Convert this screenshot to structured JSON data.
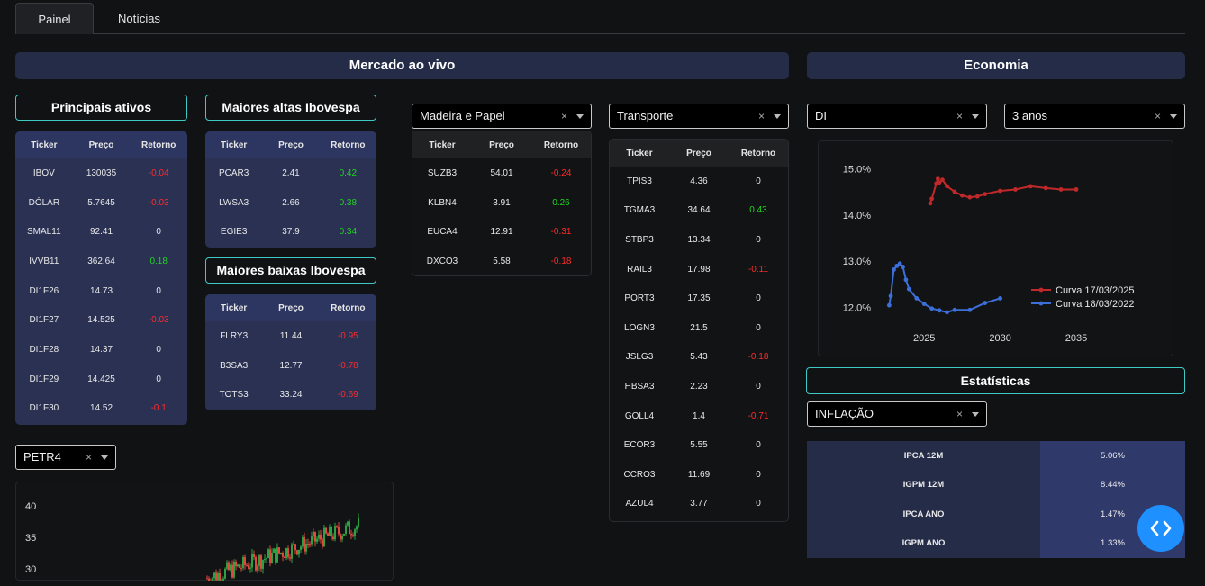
{
  "tabs": [
    "Painel",
    "Notícias"
  ],
  "sections": {
    "market": "Mercado ao vivo",
    "economy": "Economia",
    "stats": "Estatísticas"
  },
  "boxes": {
    "main_assets": "Principais ativos",
    "top_gainers": "Maiores altas Ibovespa",
    "top_losers": "Maiores baixas Ibovespa"
  },
  "table_headers": [
    "Ticker",
    "Preço",
    "Retorno"
  ],
  "main_assets": [
    [
      "IBOV",
      "130035",
      "-0.04"
    ],
    [
      "DÓLAR",
      "5.7645",
      "-0.03"
    ],
    [
      "SMAL11",
      "92.41",
      "0"
    ],
    [
      "IVVB11",
      "362.64",
      "0.18"
    ],
    [
      "DI1F26",
      "14.73",
      "0"
    ],
    [
      "DI1F27",
      "14.525",
      "-0.03"
    ],
    [
      "DI1F28",
      "14.37",
      "0"
    ],
    [
      "DI1F29",
      "14.425",
      "0"
    ],
    [
      "DI1F30",
      "14.52",
      "-0.1"
    ]
  ],
  "top_gainers": [
    [
      "PCAR3",
      "2.41",
      "0.42"
    ],
    [
      "LWSA3",
      "2.66",
      "0.38"
    ],
    [
      "EGIE3",
      "37.9",
      "0.34"
    ]
  ],
  "top_losers": [
    [
      "FLRY3",
      "11.44",
      "-0.95"
    ],
    [
      "B3SA3",
      "12.77",
      "-0.78"
    ],
    [
      "TOTS3",
      "33.24",
      "-0.69"
    ]
  ],
  "sector1": {
    "selected": "Madeira e Papel",
    "rows": [
      [
        "SUZB3",
        "54.01",
        "-0.24"
      ],
      [
        "KLBN4",
        "3.91",
        "0.26"
      ],
      [
        "EUCA4",
        "12.91",
        "-0.31"
      ],
      [
        "DXCO3",
        "5.58",
        "-0.18"
      ]
    ]
  },
  "sector2": {
    "selected": "Transporte",
    "rows": [
      [
        "TPIS3",
        "4.36",
        "0"
      ],
      [
        "TGMA3",
        "34.64",
        "0.43"
      ],
      [
        "STBP3",
        "13.34",
        "0"
      ],
      [
        "RAIL3",
        "17.98",
        "-0.11"
      ],
      [
        "PORT3",
        "17.35",
        "0"
      ],
      [
        "LOGN3",
        "21.5",
        "0"
      ],
      [
        "JSLG3",
        "5.43",
        "-0.18"
      ],
      [
        "HBSA3",
        "2.23",
        "0"
      ],
      [
        "GOLL4",
        "1.4",
        "-0.71"
      ],
      [
        "ECOR3",
        "5.55",
        "0"
      ],
      [
        "CCRO3",
        "11.69",
        "0"
      ],
      [
        "AZUL4",
        "3.77",
        "0"
      ]
    ]
  },
  "economy": {
    "curve_selected": "DI",
    "period_selected": "3 anos"
  },
  "stock_select": "PETR4",
  "stats_select": "INFLAÇÃO",
  "stats_rows": [
    [
      "IPCA 12M",
      "5.06%"
    ],
    [
      "IGPM 12M",
      "8.44%"
    ],
    [
      "IPCA ANO",
      "1.47%"
    ],
    [
      "IGPM ANO",
      "1.33%"
    ]
  ],
  "clear_glyph": "×",
  "chart_data": [
    {
      "type": "line",
      "title": "",
      "xlabel": "",
      "ylabel": "",
      "x_ticks": [
        2025,
        2030,
        2035
      ],
      "y_ticks": [
        "12.0%",
        "13.0%",
        "14.0%",
        "15.0%"
      ],
      "ylim": [
        11.8,
        15.2
      ],
      "xlim": [
        2022.5,
        2038.2
      ],
      "legend": "right",
      "series": [
        {
          "name": "Curva 17/03/2025",
          "color": "#c0282a",
          "x": [
            2025.4,
            2025.5,
            2025.8,
            2025.9,
            2026.0,
            2026.2,
            2026.5,
            2027.0,
            2027.5,
            2028.0,
            2028.5,
            2029.0,
            2030.0,
            2031.0,
            2032.0,
            2033.0,
            2034.0,
            2035.0
          ],
          "y": [
            14.25,
            14.35,
            14.68,
            14.78,
            14.7,
            14.76,
            14.62,
            14.5,
            14.42,
            14.38,
            14.4,
            14.45,
            14.52,
            14.55,
            14.62,
            14.58,
            14.55,
            14.55
          ]
        },
        {
          "name": "Curva 18/03/2022",
          "color": "#3d6fd9",
          "x": [
            2022.7,
            2022.8,
            2023.0,
            2023.2,
            2023.4,
            2023.6,
            2023.8,
            2024.0,
            2024.5,
            2025.0,
            2025.5,
            2026.0,
            2026.5,
            2027.0,
            2028.0,
            2029.0,
            2030.0
          ],
          "y": [
            12.05,
            12.25,
            12.82,
            12.9,
            12.95,
            12.88,
            12.6,
            12.4,
            12.2,
            12.08,
            11.98,
            11.94,
            11.9,
            11.95,
            11.95,
            12.1,
            12.2
          ]
        }
      ]
    },
    {
      "type": "candlestick",
      "title": "",
      "y_ticks": [
        30,
        35,
        40
      ],
      "ylim": [
        25,
        42
      ],
      "series_summary": "PETR4 daily candles rising from ~29 to ~38"
    }
  ]
}
